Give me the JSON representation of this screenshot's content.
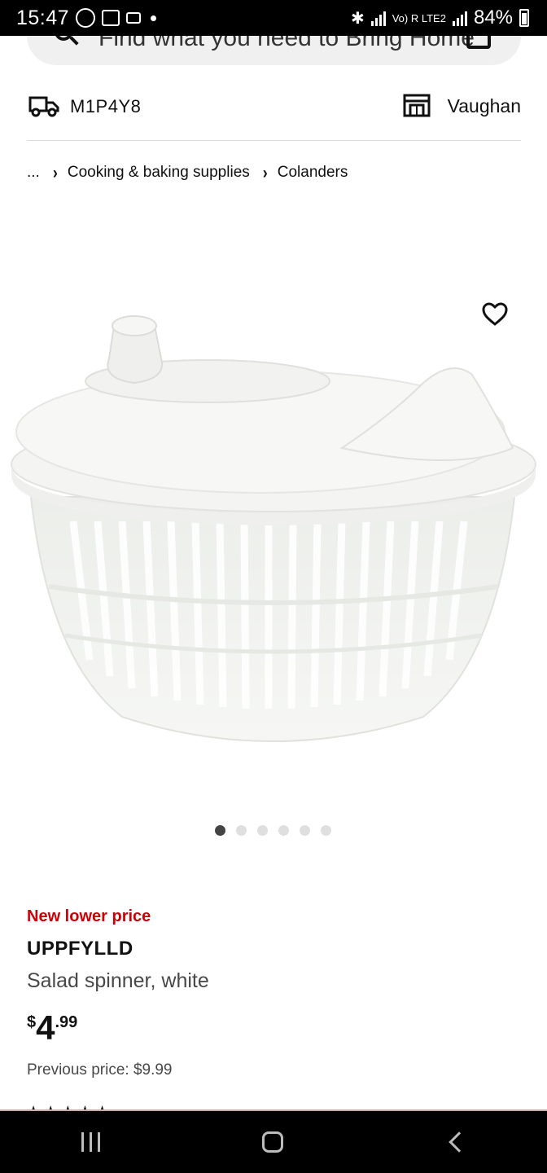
{
  "status_bar": {
    "time": "15:47",
    "network": "Vo) R LTE2",
    "battery": "84%"
  },
  "search": {
    "placeholder": "Find what you need to Bring Home"
  },
  "location": {
    "postal_code": "M1P4Y8",
    "store": "Vaughan"
  },
  "breadcrumb": {
    "items": [
      "...",
      "Cooking & baking supplies",
      "Colanders"
    ]
  },
  "product": {
    "image_icon": "salad-spinner-image",
    "carousel_count": 6,
    "carousel_active": 0,
    "badge": "New lower price",
    "badge_color": "#cc0008",
    "name": "UPPFYLLD",
    "description": "Salad spinner, white",
    "price_currency": "$",
    "price_int": "4",
    "price_dec": ".99",
    "previous_price": "Previous price: $9.99"
  },
  "nav_bar": {
    "recents_icon": "recents-icon",
    "home_icon": "home-icon",
    "back_icon": "back-icon"
  }
}
